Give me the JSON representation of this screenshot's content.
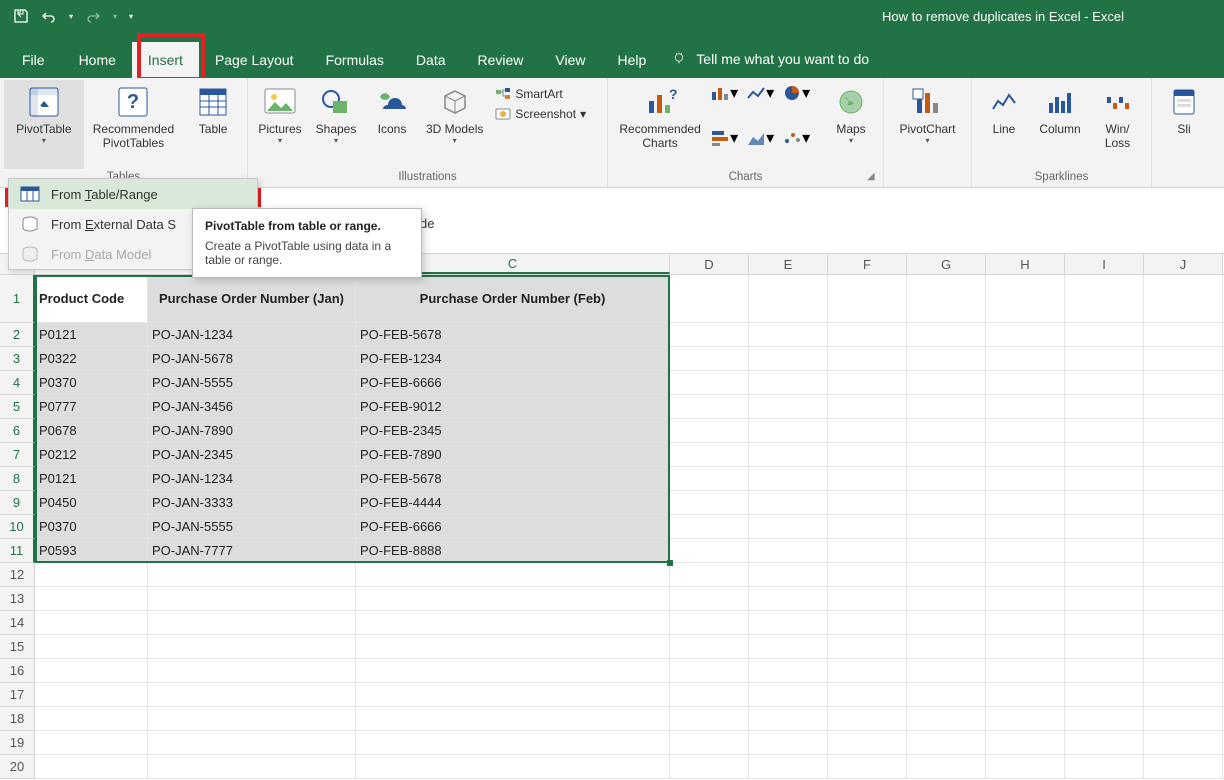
{
  "titlebar": {
    "title": "How to remove duplicates in Excel  -  Excel"
  },
  "menu": {
    "file": "File",
    "home": "Home",
    "insert": "Insert",
    "page_layout": "Page Layout",
    "formulas": "Formulas",
    "data": "Data",
    "review": "Review",
    "view": "View",
    "help": "Help",
    "tellme": "Tell me what you want to do"
  },
  "ribbon": {
    "tables_group": "Tables",
    "pivottable": "PivotTable",
    "recommended_pivot": "Recommended PivotTables",
    "table": "Table",
    "pictures": "Pictures",
    "shapes": "Shapes",
    "icons": "Icons",
    "models3d": "3D Models",
    "illustrations_group": "Illustrations",
    "smartart": "SmartArt",
    "screenshot": "Screenshot",
    "recommended_charts": "Recommended Charts",
    "charts_group": "Charts",
    "maps": "Maps",
    "pivotchart": "PivotChart",
    "line": "Line",
    "column": "Column",
    "winloss": "Win/ Loss",
    "sparklines_group": "Sparklines",
    "slicer": "Sli"
  },
  "dropdown": {
    "from_table": "From Table/Range",
    "from_external": "From External Data Source",
    "from_model": "From Data Model",
    "from_table_prefix": "From ",
    "from_table_t": "T",
    "from_table_rest": "able/Range",
    "ext_prefix": "From ",
    "ext_e": "E",
    "ext_rest": "xternal Data S",
    "model_prefix": "From ",
    "model_d": "D",
    "model_rest": "ata Model"
  },
  "tooltip": {
    "title": "PivotTable from table or range.",
    "body": "Create a PivotTable using data in a table or range."
  },
  "fx_fragment": "de",
  "columns": [
    "C",
    "D",
    "E",
    "F",
    "G",
    "H",
    "I",
    "J"
  ],
  "headers": {
    "A": "Product Code",
    "B": "Purchase Order Number (Jan)",
    "C": "Purchase Order Number (Feb)"
  },
  "data_rows": [
    {
      "n": 2,
      "a": "P0121",
      "b": "PO-JAN-1234",
      "c": "PO-FEB-5678"
    },
    {
      "n": 3,
      "a": "P0322",
      "b": "PO-JAN-5678",
      "c": "PO-FEB-1234"
    },
    {
      "n": 4,
      "a": "P0370",
      "b": "PO-JAN-5555",
      "c": "PO-FEB-6666"
    },
    {
      "n": 5,
      "a": "P0777",
      "b": "PO-JAN-3456",
      "c": "PO-FEB-9012"
    },
    {
      "n": 6,
      "a": "P0678",
      "b": "PO-JAN-7890",
      "c": "PO-FEB-2345"
    },
    {
      "n": 7,
      "a": "P0212",
      "b": "PO-JAN-2345",
      "c": "PO-FEB-7890"
    },
    {
      "n": 8,
      "a": "P0121",
      "b": "PO-JAN-1234",
      "c": "PO-FEB-5678"
    },
    {
      "n": 9,
      "a": "P0450",
      "b": "PO-JAN-3333",
      "c": "PO-FEB-4444"
    },
    {
      "n": 10,
      "a": "P0370",
      "b": "PO-JAN-5555",
      "c": "PO-FEB-6666"
    },
    {
      "n": 11,
      "a": "P0593",
      "b": "PO-JAN-7777",
      "c": "PO-FEB-8888"
    }
  ]
}
